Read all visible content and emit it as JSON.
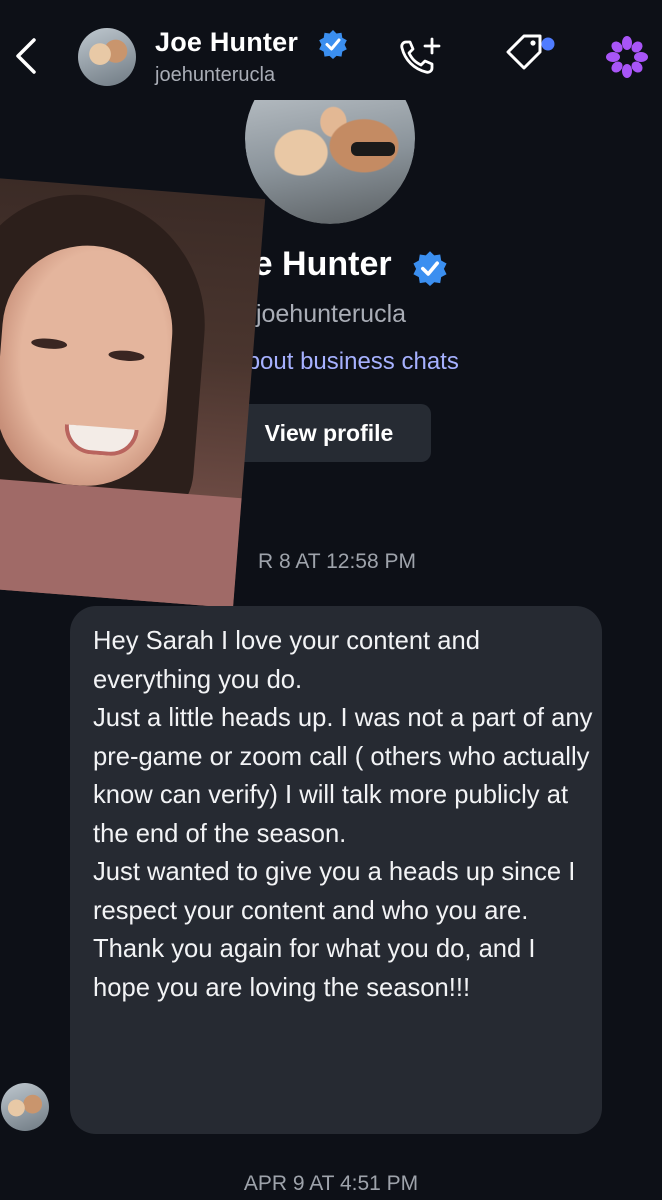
{
  "header": {
    "name": "Joe Hunter",
    "username": "joehunterucla",
    "icons": [
      "back-icon",
      "verified-icon",
      "call-add-icon",
      "tag-icon",
      "flower-icon"
    ]
  },
  "profile": {
    "name": "Joe Hunter",
    "username": "joehunterucla",
    "business_link": "arn about business chats",
    "view_profile_label": "View profile"
  },
  "timestamps": {
    "first": "R 8 AT 12:58 PM",
    "second": "APR 9 AT 4:51 PM"
  },
  "message": {
    "paragraphs": [
      "Hey Sarah I love your content and everything you do.",
      "Just a little heads up. I was not a part of any pre-game or zoom call ( others who actually know can verify) I will talk more publicly at the end of the season.",
      "Just wanted to give you a heads up since I respect your content and who you are.",
      "Thank you again for what you do, and I hope you are loving the season!!!"
    ]
  },
  "colors": {
    "background": "#0d1017",
    "bubble": "#262a32",
    "verified": "#3b8ff0",
    "link": "#a6b1ff",
    "muted": "#a9adb6",
    "accent_purple": "#a855f7"
  }
}
